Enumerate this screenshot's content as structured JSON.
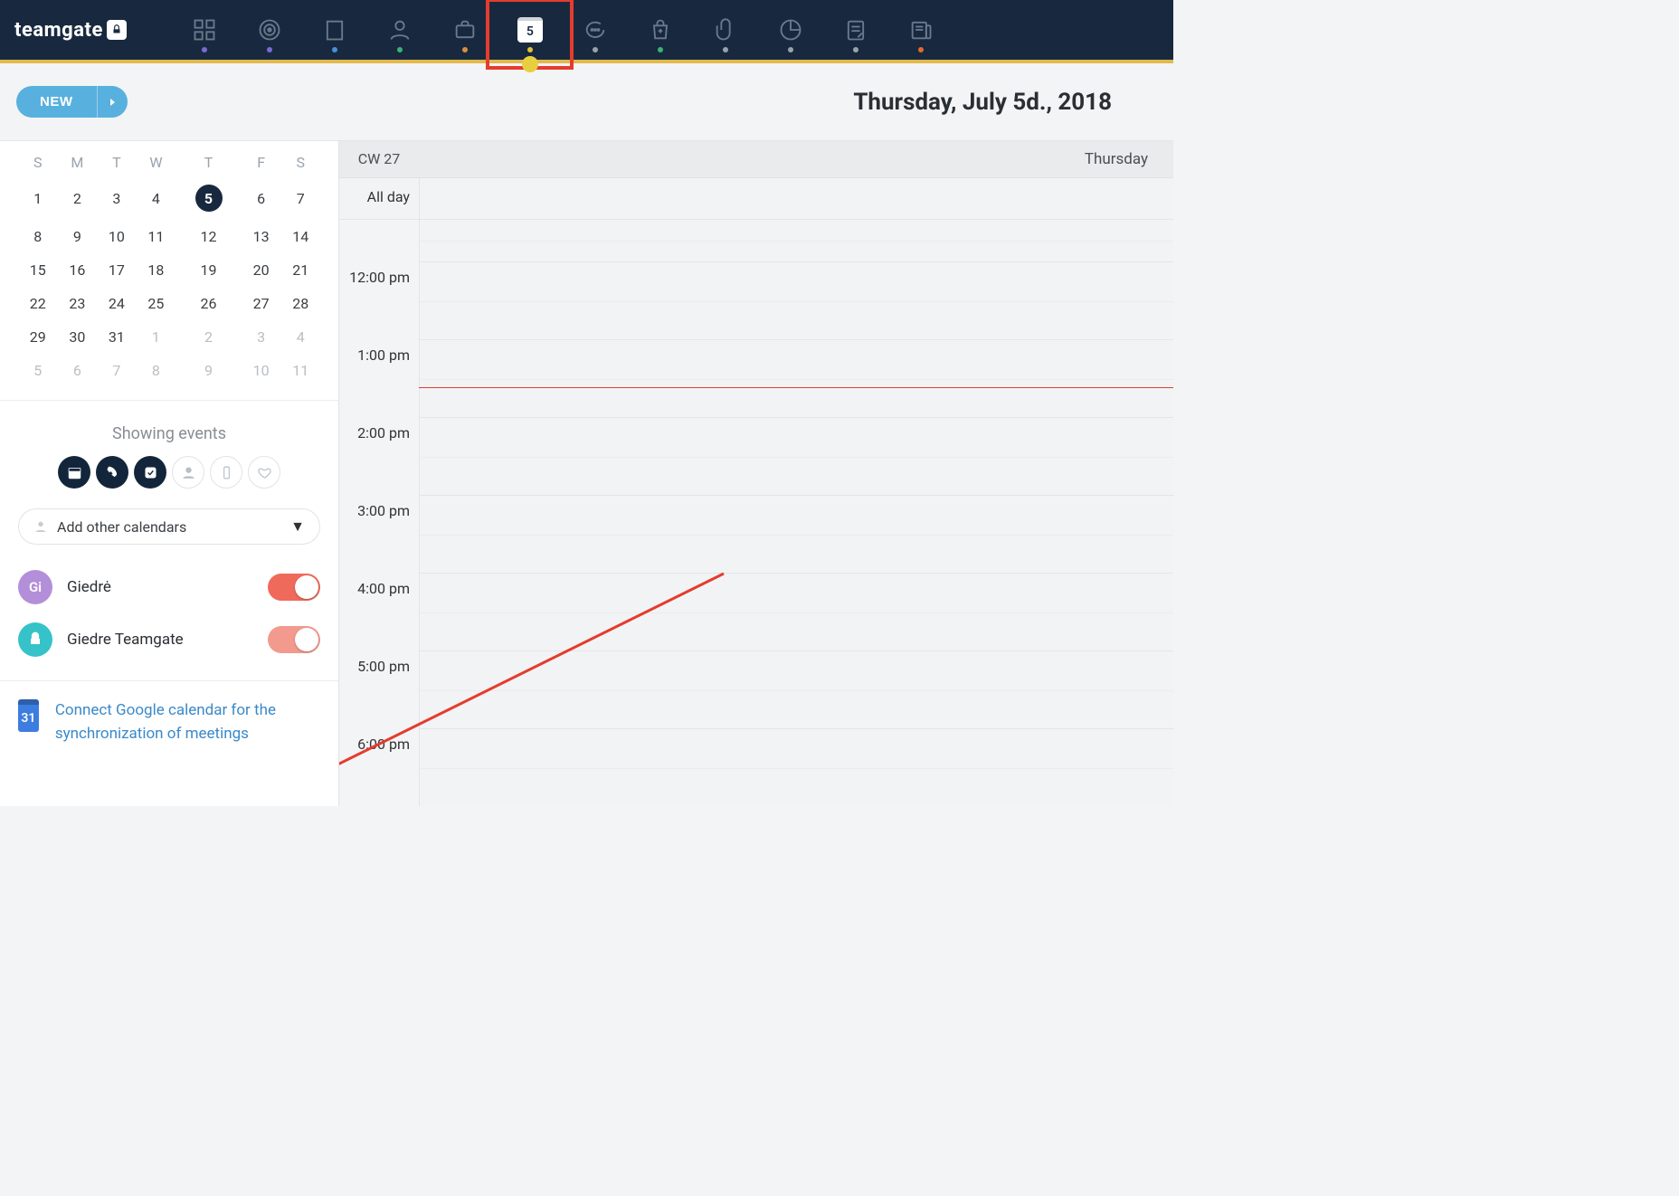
{
  "brand": "teamgate",
  "nav": {
    "calendar_day": "5",
    "icons": [
      {
        "name": "dashboard-icon",
        "dot": "d-purple"
      },
      {
        "name": "target-icon",
        "dot": "d-purple"
      },
      {
        "name": "building-icon",
        "dot": "d-blue"
      },
      {
        "name": "person-icon",
        "dot": "d-green"
      },
      {
        "name": "briefcase-icon",
        "dot": "d-orange"
      },
      {
        "name": "calendar-icon",
        "dot": "d-yellow",
        "active": true
      },
      {
        "name": "chat-icon",
        "dot": "d-grey"
      },
      {
        "name": "bag-icon",
        "dot": "d-green2"
      },
      {
        "name": "attachment-icon",
        "dot": "d-grey2"
      },
      {
        "name": "piechart-icon",
        "dot": "d-grey"
      },
      {
        "name": "note-icon",
        "dot": "d-grey2"
      },
      {
        "name": "news-icon",
        "dot": "d-dorange"
      }
    ]
  },
  "header": {
    "new_label": "NEW",
    "date_title": "Thursday, July 5d., 2018"
  },
  "mini_calendar": {
    "dow": [
      "S",
      "M",
      "T",
      "W",
      "T",
      "F",
      "S"
    ],
    "weeks": [
      [
        {
          "d": "1"
        },
        {
          "d": "2"
        },
        {
          "d": "3"
        },
        {
          "d": "4"
        },
        {
          "d": "5",
          "sel": true
        },
        {
          "d": "6"
        },
        {
          "d": "7"
        }
      ],
      [
        {
          "d": "8"
        },
        {
          "d": "9"
        },
        {
          "d": "10"
        },
        {
          "d": "11"
        },
        {
          "d": "12"
        },
        {
          "d": "13"
        },
        {
          "d": "14"
        }
      ],
      [
        {
          "d": "15"
        },
        {
          "d": "16"
        },
        {
          "d": "17"
        },
        {
          "d": "18"
        },
        {
          "d": "19"
        },
        {
          "d": "20"
        },
        {
          "d": "21"
        }
      ],
      [
        {
          "d": "22"
        },
        {
          "d": "23"
        },
        {
          "d": "24"
        },
        {
          "d": "25"
        },
        {
          "d": "26"
        },
        {
          "d": "27"
        },
        {
          "d": "28"
        }
      ],
      [
        {
          "d": "29"
        },
        {
          "d": "30"
        },
        {
          "d": "31"
        },
        {
          "d": "1",
          "other": true
        },
        {
          "d": "2",
          "other": true
        },
        {
          "d": "3",
          "other": true
        },
        {
          "d": "4",
          "other": true
        }
      ],
      [
        {
          "d": "5",
          "other": true
        },
        {
          "d": "6",
          "other": true
        },
        {
          "d": "7",
          "other": true
        },
        {
          "d": "8",
          "other": true
        },
        {
          "d": "9",
          "other": true
        },
        {
          "d": "10",
          "other": true
        },
        {
          "d": "11",
          "other": true
        }
      ]
    ]
  },
  "filters_title": "Showing events",
  "calendar_select_label": "Add other calendars",
  "calendars": [
    {
      "initials": "Gi",
      "name": "Giedrė",
      "kind": "purple",
      "on": true,
      "switch": "on"
    },
    {
      "initials": "",
      "name": "Giedre Teamgate",
      "kind": "teal",
      "on": true,
      "switch": "soft"
    }
  ],
  "google_link_text": "Connect Google calendar for the synchronization of meetings",
  "google_icon_day": "31",
  "daygrid": {
    "week_label": "CW 27",
    "day_label": "Thursday",
    "allday_label": "All day",
    "times": [
      "12:00 pm",
      "1:00 pm",
      "2:00 pm",
      "3:00 pm",
      "4:00 pm",
      "5:00 pm",
      "6:00 pm"
    ]
  }
}
